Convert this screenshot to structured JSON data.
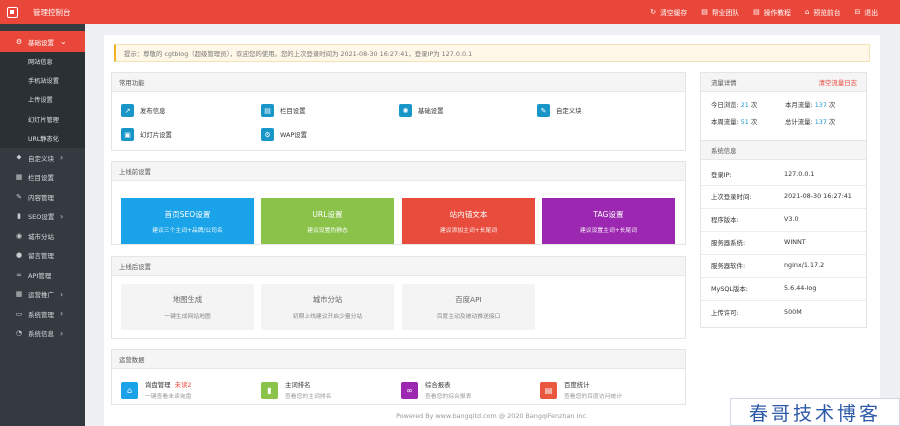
{
  "header": {
    "title": "管理控制台",
    "actions": [
      {
        "icon": "refresh-icon",
        "glyph": "↻",
        "label": "清空缓存"
      },
      {
        "icon": "book-icon",
        "glyph": "▤",
        "label": "帮业团队"
      },
      {
        "icon": "guide-icon",
        "glyph": "▤",
        "label": "操作教程"
      },
      {
        "icon": "home-icon",
        "glyph": "⌂",
        "label": "预览前台"
      },
      {
        "icon": "logout-icon",
        "glyph": "⊟",
        "label": "退出"
      }
    ]
  },
  "sidebar": {
    "active": {
      "icon": "gear-icon",
      "glyph": "⚙",
      "label": "基础设置"
    },
    "sub_items": [
      "网站信息",
      "手机站设置",
      "上传设置",
      "幻灯片管理",
      "URL静态化"
    ],
    "items": [
      {
        "icon": "tag-icon",
        "glyph": "⬥",
        "label": "自定义块",
        "arrow": true
      },
      {
        "icon": "grid-icon",
        "glyph": "▦",
        "label": "栏目设置",
        "arrow": false
      },
      {
        "icon": "edit-icon",
        "glyph": "✎",
        "label": "内容管理",
        "arrow": false
      },
      {
        "icon": "chart-icon",
        "glyph": "▮",
        "label": "SEO设置",
        "arrow": true
      },
      {
        "icon": "globe-icon",
        "glyph": "◉",
        "label": "城市分站",
        "arrow": false
      },
      {
        "icon": "comment-icon",
        "glyph": "●",
        "label": "留言管理",
        "arrow": false
      },
      {
        "icon": "link-icon",
        "glyph": "∞",
        "label": "API管理",
        "arrow": false
      },
      {
        "icon": "table-icon",
        "glyph": "▦",
        "label": "运营推广",
        "arrow": true
      },
      {
        "icon": "monitor-icon",
        "glyph": "▭",
        "label": "系统管理",
        "arrow": true
      },
      {
        "icon": "dashboard-icon",
        "glyph": "◔",
        "label": "系统信息",
        "arrow": true
      }
    ]
  },
  "notice": "提示：尊敬的 cgtblog（超级管理员），欢迎您的使用。您的上次登录时间为 2021-08-30 16:27:41，登录IP为 127.0.0.1",
  "common_functions": {
    "title": "常用功能",
    "items": [
      {
        "icon": "publish-icon",
        "glyph": "↗",
        "label": "发布信息"
      },
      {
        "icon": "column-icon",
        "glyph": "▤",
        "label": "栏目设置"
      },
      {
        "icon": "gear-icon",
        "glyph": "✺",
        "label": "基础设置"
      },
      {
        "icon": "custom-block-icon",
        "glyph": "✎",
        "label": "自定义块"
      },
      {
        "icon": "slideshow-icon",
        "glyph": "▣",
        "label": "幻灯片设置"
      },
      {
        "icon": "wap-gear-icon",
        "glyph": "⚙",
        "label": "WAP设置"
      }
    ]
  },
  "before_launch": {
    "title": "上线前设置",
    "cards": [
      {
        "title": "首页SEO设置",
        "desc": "建议三个主词+品牌/公司名",
        "color": "#1aa3e8"
      },
      {
        "title": "URL设置",
        "desc": "建议设置伪静态",
        "color": "#8bc34a"
      },
      {
        "title": "站内锚文本",
        "desc": "建议添加主词+长尾词",
        "color": "#e74c3c"
      },
      {
        "title": "TAG设置",
        "desc": "建议设置主词+长尾词",
        "color": "#9c27b0"
      }
    ]
  },
  "after_launch": {
    "title": "上线后设置",
    "cards": [
      {
        "title": "地图生成",
        "desc": "一键生成网站地图"
      },
      {
        "title": "城市分站",
        "desc": "初期上线建议开启少量分站"
      },
      {
        "title": "百度API",
        "desc": "百度主动及被动推送接口"
      }
    ]
  },
  "operations": {
    "title": "运营数据",
    "items": [
      {
        "icon": "inquiry-icon",
        "glyph": "⌂",
        "color": "#1aa3e8",
        "label": "询盘管理",
        "badge": "未读2",
        "desc": "一键查看未读询盘"
      },
      {
        "icon": "bar-chart-icon",
        "glyph": "▮",
        "color": "#8bc34a",
        "label": "主词排名",
        "badge": "",
        "desc": "查看您的主词排名"
      },
      {
        "icon": "report-link-icon",
        "glyph": "∞",
        "color": "#9c27b0",
        "label": "综合报表",
        "badge": "",
        "desc": "查看您的综合报表"
      },
      {
        "icon": "baidu-stats-icon",
        "glyph": "▤",
        "color": "#e9573f",
        "label": "百度统计",
        "badge": "",
        "desc": "查看您的百度访问统计"
      }
    ]
  },
  "traffic": {
    "title": "流量详情",
    "clear_link": "清空流量日志",
    "today_label": "今日浏览:",
    "today_value": "21",
    "today_unit": "次",
    "month_label": "本月流量:",
    "month_value": "137",
    "month_unit": "次",
    "week_label": "本周流量:",
    "week_value": "51",
    "week_unit": "次",
    "total_label": "总计流量:",
    "total_value": "137",
    "total_unit": "次"
  },
  "system": {
    "title": "系统信息",
    "rows": [
      {
        "k": "登录IP:",
        "v": "127.0.0.1"
      },
      {
        "k": "上次登录时间:",
        "v": "2021-08-30 16:27:41"
      },
      {
        "k": "程序版本:",
        "v": "V3.0"
      },
      {
        "k": "服务器系统:",
        "v": "WINNT"
      },
      {
        "k": "服务器软件:",
        "v": "nginx/1.17.2"
      },
      {
        "k": "MySQL版本:",
        "v": "5.6.44-log"
      },
      {
        "k": "上传许可:",
        "v": "500M"
      }
    ]
  },
  "footer": "Powered By www.bangqitd.com @ 2020 BangqiFenzhan Inc.",
  "watermark": "春哥技术博客"
}
